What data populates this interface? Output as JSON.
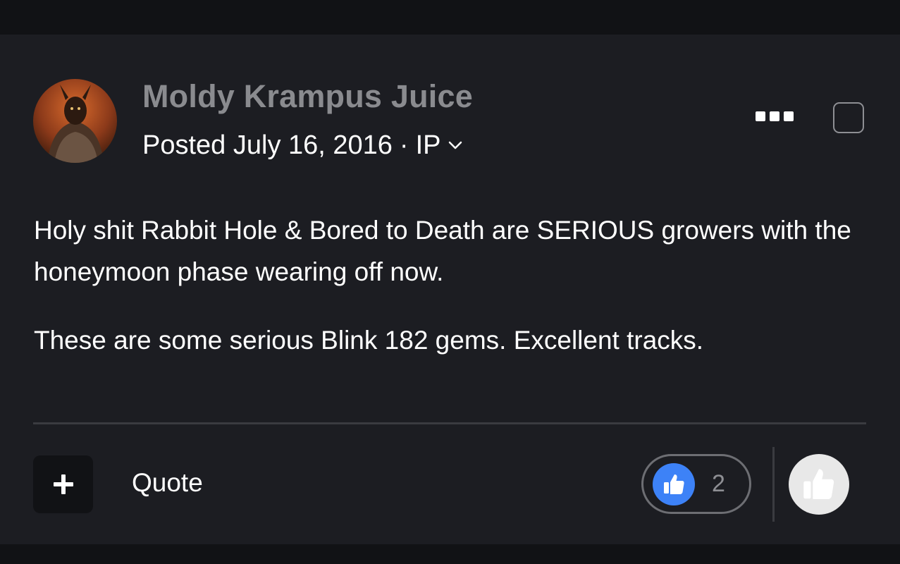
{
  "post": {
    "author": "Moldy Krampus Juice",
    "posted_label": "Posted July 16, 2016",
    "separator": "·",
    "ip_label": "IP",
    "paragraphs": [
      "Holy shit Rabbit Hole & Bored to Death are SERIOUS growers with the honeymoon phase wearing off now.",
      "These are some serious Blink 182 gems. Excellent tracks."
    ]
  },
  "footer": {
    "quote_label": "Quote",
    "reaction_count": "2"
  },
  "icons": {
    "more": "ellipsis-icon",
    "select": "checkbox-icon",
    "plus": "plus-icon",
    "like": "thumbs-up-icon",
    "react": "thumbs-up-icon",
    "ip_dropdown": "chevron-down-icon"
  },
  "colors": {
    "background": "#1c1d22",
    "page_background": "#111215",
    "like_accent": "#3d82f7",
    "author_text": "#8a8b8f"
  }
}
